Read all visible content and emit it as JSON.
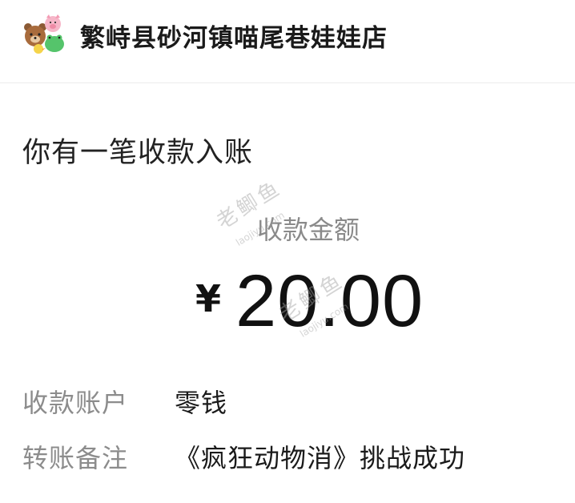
{
  "header": {
    "shop_name": "繁峙县砂河镇喵尾巷娃娃店"
  },
  "notice": {
    "title": "你有一笔收款入账"
  },
  "amount": {
    "label": "收款金额",
    "currency_symbol": "¥",
    "value": "20.00"
  },
  "details": {
    "account_label": "收款账户",
    "account_value": "零钱",
    "remark_label": "转账备注",
    "remark_value": "《疯狂动物消》挑战成功"
  },
  "watermark": {
    "cn": "老鲫鱼",
    "url": "laojiyu.com"
  }
}
